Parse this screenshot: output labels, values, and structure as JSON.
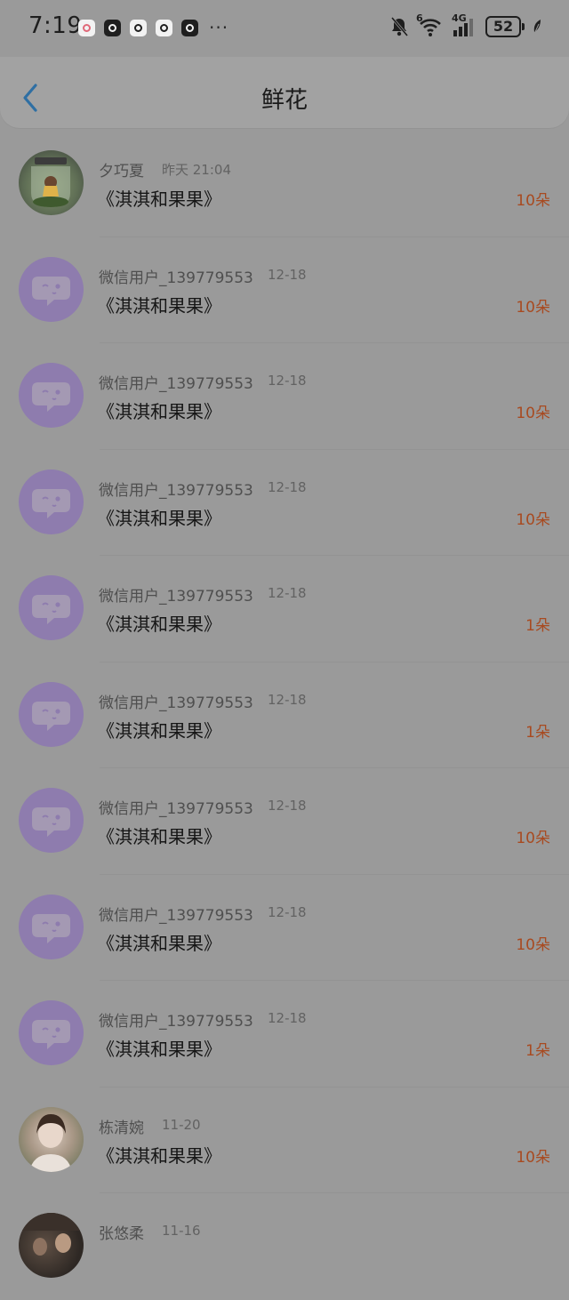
{
  "status_bar": {
    "time": "7:19",
    "notification_icons": [
      "app-icon-pink",
      "app-icon-dark",
      "app-icon-light",
      "app-icon-light-2",
      "app-icon-dark-2"
    ],
    "more": "···",
    "signal_superscript": "6",
    "network": "4G",
    "battery": "52",
    "mute_icon": "bell-off-icon",
    "wifi_icon": "wifi-icon",
    "cellular_icon": "cellular-signal-icon",
    "leaf_icon": "leaf-icon"
  },
  "header": {
    "title": "鲜花",
    "back_icon": "chevron-left-icon",
    "accent_color": "#2f6fa3"
  },
  "colors": {
    "background": "#9a9a9a",
    "count": "#a84a20",
    "default_avatar": "#8e7cae"
  },
  "items": [
    {
      "name": "夕巧夏",
      "time": "昨天 21:04",
      "target": "《淇淇和果果》",
      "count": "10朵",
      "avatar": "photo-jar"
    },
    {
      "name": "微信用户_139779553",
      "time": "12-18",
      "target": "《淇淇和果果》",
      "count": "10朵",
      "avatar": "default"
    },
    {
      "name": "微信用户_139779553",
      "time": "12-18",
      "target": "《淇淇和果果》",
      "count": "10朵",
      "avatar": "default"
    },
    {
      "name": "微信用户_139779553",
      "time": "12-18",
      "target": "《淇淇和果果》",
      "count": "10朵",
      "avatar": "default"
    },
    {
      "name": "微信用户_139779553",
      "time": "12-18",
      "target": "《淇淇和果果》",
      "count": "1朵",
      "avatar": "default"
    },
    {
      "name": "微信用户_139779553",
      "time": "12-18",
      "target": "《淇淇和果果》",
      "count": "1朵",
      "avatar": "default"
    },
    {
      "name": "微信用户_139779553",
      "time": "12-18",
      "target": "《淇淇和果果》",
      "count": "10朵",
      "avatar": "default"
    },
    {
      "name": "微信用户_139779553",
      "time": "12-18",
      "target": "《淇淇和果果》",
      "count": "10朵",
      "avatar": "default"
    },
    {
      "name": "微信用户_139779553",
      "time": "12-18",
      "target": "《淇淇和果果》",
      "count": "1朵",
      "avatar": "default"
    },
    {
      "name": "栋清婉",
      "time": "11-20",
      "target": "《淇淇和果果》",
      "count": "10朵",
      "avatar": "photo-girl"
    },
    {
      "name": "张悠柔",
      "time": "11-16",
      "target": "",
      "count": "",
      "avatar": "photo-dark"
    }
  ]
}
